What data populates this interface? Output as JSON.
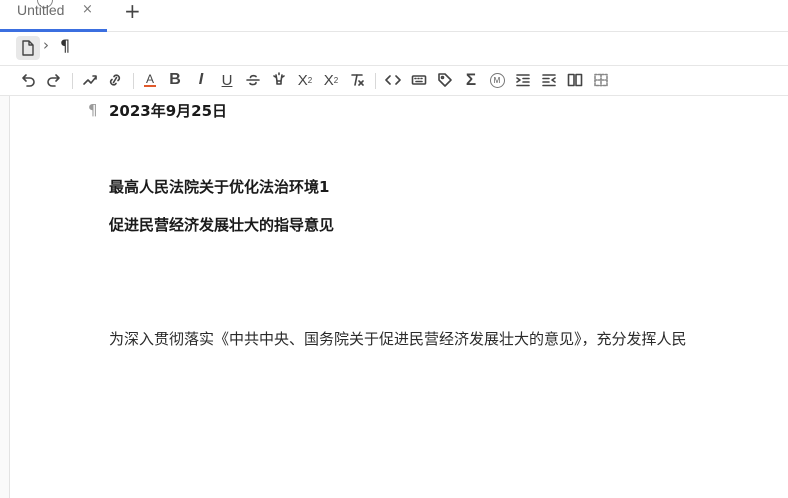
{
  "tabs": [
    {
      "title": "Untitled",
      "close": "×",
      "active": true
    }
  ],
  "new_tab": "+",
  "breadcrumb": {
    "separator": "›",
    "paragraph_mark": "¶"
  },
  "toolbar": {
    "items": [
      "undo-icon",
      "redo-icon",
      "highlight-icon",
      "link-icon",
      "font-color-icon",
      "bold-icon",
      "italic-icon",
      "underline-icon",
      "strikethrough-icon",
      "marker-icon",
      "superscript-icon",
      "subscript-icon",
      "clear-format-icon",
      "code-icon",
      "keyboard-icon",
      "tag-icon",
      "sigma-icon",
      "mention-icon",
      "indent-icon",
      "outdent-icon",
      "columns-icon",
      "table-icon"
    ],
    "bold": "B",
    "italic": "I",
    "underline": "U",
    "superscript": "X",
    "subscript": "X",
    "font_color": "A",
    "sigma": "Σ",
    "mention": "M"
  },
  "document": {
    "paragraph_mark": "¶",
    "date": "2023年9月25日",
    "title_line1": "最高人民法院关于优化法治环境1",
    "title_line2": "促进民营经济发展壮大的指导意见",
    "body": "为深入贯彻落实《中共中央、国务院关于促进民营经济发展壮大的意见》，充分发挥人民"
  },
  "colors": {
    "accent": "#3b6fe0"
  }
}
